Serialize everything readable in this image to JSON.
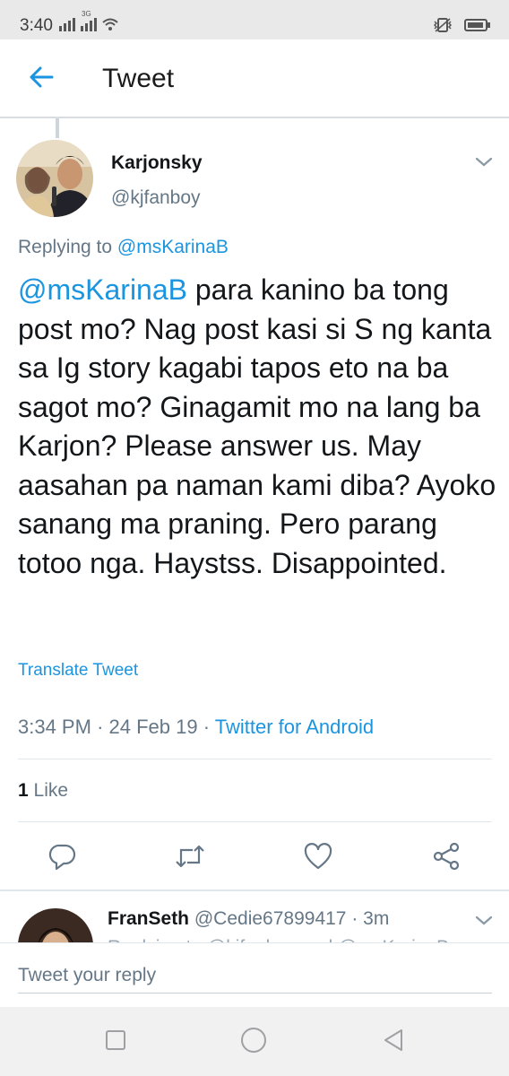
{
  "status_bar": {
    "time": "3:40",
    "network_label": "3G",
    "icons": [
      "hd-signal-icon",
      "signal-3g-icon",
      "wifi-icon",
      "vibrate-icon",
      "battery-icon"
    ]
  },
  "app_bar": {
    "back_icon": "arrow-left-icon",
    "title": "Tweet"
  },
  "tweet": {
    "author_name": "Karjonsky",
    "author_handle": "@kjfanboy",
    "replying_prefix": "Replying to",
    "replying_to": "@msKarinaB",
    "text_mention": "@msKarinaB",
    "text_body": " para kanino ba tong post mo? Nag post kasi si S ng kanta sa Ig story kagabi  tapos eto na ba sagot mo? Ginagamit mo na lang ba Karjon? Please answer us. May aasahan pa naman kami diba? Ayoko sanang ma praning. Pero parang totoo nga. Haystss. Disappointed.",
    "translate_label": "Translate Tweet",
    "time": "3:34 PM",
    "separator": "·",
    "date": "24 Feb 19",
    "source": "Twitter for Android",
    "like_count": "1",
    "like_label": "Like"
  },
  "actions": [
    "reply-icon",
    "retweet-icon",
    "like-icon",
    "share-icon"
  ],
  "reply": {
    "name": "FranSeth",
    "handle": "@Cedie67899417",
    "separator": "·",
    "time": "3m",
    "text_line": "Replying to @kjfanboy and @msKarinaB"
  },
  "compose": {
    "placeholder": "Tweet your reply"
  },
  "nav_bar": [
    "recents-square-icon",
    "home-circle-icon",
    "back-triangle-icon"
  ],
  "colors": {
    "accent": "#1b95e0",
    "secondary_text": "#657786",
    "status_bar_bg": "#e9e9ea"
  }
}
